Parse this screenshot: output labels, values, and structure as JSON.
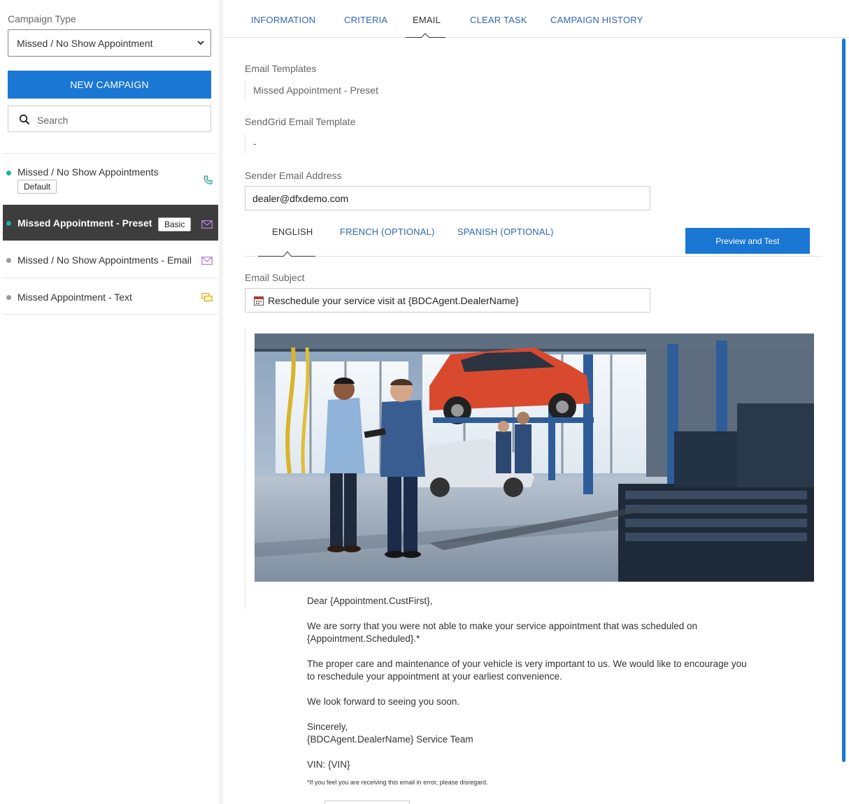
{
  "sidebar": {
    "campaign_type_label": "Campaign Type",
    "campaign_type_value": "Missed / No Show Appointment",
    "new_campaign_label": "NEW CAMPAIGN",
    "search_placeholder": "Search",
    "campaigns": [
      {
        "name": "Missed / No Show Appointments",
        "badge": "Default",
        "icon": "phone-icon",
        "dot_color": "#19b3a6",
        "active": false
      },
      {
        "name": "Missed Appointment - Preset",
        "badge": "Basic",
        "icon": "mail-icon",
        "dot_color": "#19b3a6",
        "active": true
      },
      {
        "name": "Missed / No Show Appointments - Email",
        "badge": "",
        "icon": "mail-icon",
        "dot_color": "#999999",
        "active": false
      },
      {
        "name": "Missed Appointment - Text",
        "badge": "",
        "icon": "chat-icon",
        "dot_color": "#999999",
        "active": false
      }
    ]
  },
  "tabs": [
    {
      "label": "INFORMATION",
      "active": false
    },
    {
      "label": "CRITERIA",
      "active": false
    },
    {
      "label": "EMAIL",
      "active": true
    },
    {
      "label": "CLEAR TASK",
      "active": false
    },
    {
      "label": "CAMPAIGN HISTORY",
      "active": false
    }
  ],
  "email": {
    "templates_label": "Email Templates",
    "templates_value": "Missed Appointment - Preset",
    "sendgrid_label": "SendGrid Email Template",
    "sendgrid_value": "-",
    "sender_label": "Sender Email Address",
    "sender_value": "dealer@dfxdemo.com",
    "language_tabs": [
      {
        "label": "ENGLISH",
        "active": true
      },
      {
        "label": "FRENCH (OPTIONAL)",
        "active": false
      },
      {
        "label": "SPANISH (OPTIONAL)",
        "active": false
      }
    ],
    "preview_button": "Preview and Test",
    "subject_label": "Email Subject",
    "subject_value": "Reschedule your service visit at {BDCAgent.DealerName}",
    "body": {
      "greeting": "Dear {Appointment.CustFirst},",
      "para1_line1": "We are sorry that you were not able to make your service appointment that was scheduled on",
      "para1_line2": "{Appointment.Scheduled}.*",
      "para2_line1": "The proper care and maintenance of your vehicle is very important to us. We would like to encourage you",
      "para2_line2": "to reschedule your appointment at your earliest convenience.",
      "para3": "We look forward to seeing you soon.",
      "sign1": "Sincerely,",
      "sign2": "{BDCAgent.DealerName} Service Team",
      "vin": "VIN: {VIN}",
      "footnote": "*If you feel you are receiving this email in error, please disregard."
    }
  },
  "colors": {
    "primary": "#1a77d4",
    "link": "#2e67b5",
    "active_row": "#3d3d3d"
  }
}
